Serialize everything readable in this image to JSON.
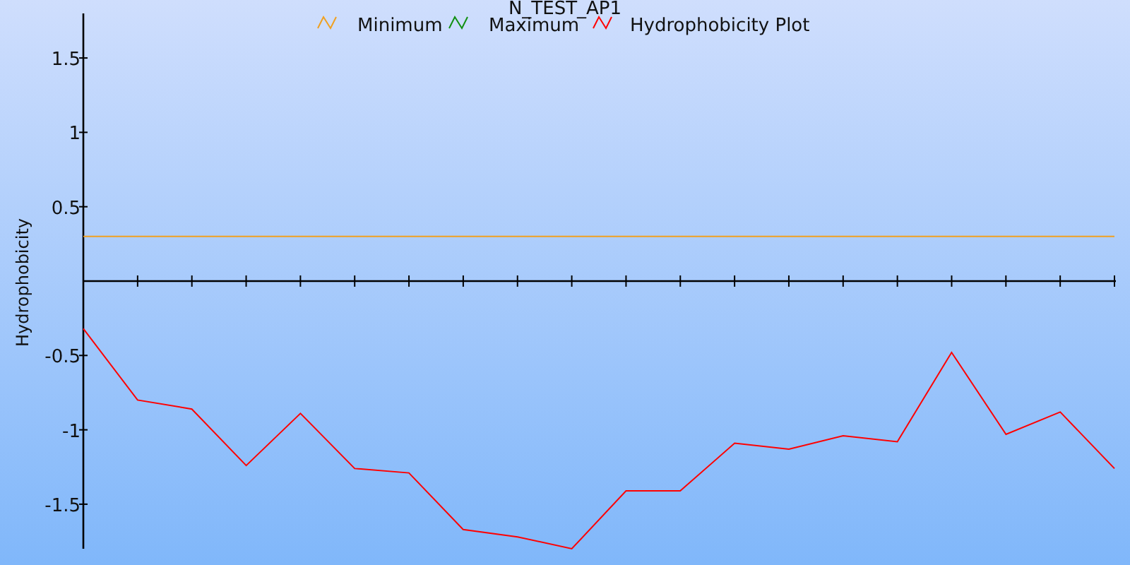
{
  "chart": {
    "chart_data": {
      "type": "line",
      "title": "N_TEST_AP1",
      "ylabel": "Hydrophobicity",
      "legend": true,
      "ylim": [
        -1.8,
        1.8
      ],
      "yticks": [
        -1.5,
        -1,
        -0.5,
        0.5,
        1,
        1.5
      ],
      "series": [
        {
          "name": "Minimum",
          "color": "#f0a020",
          "values": [
            0.3,
            0.3,
            0.3,
            0.3,
            0.3,
            0.3,
            0.3,
            0.3,
            0.3,
            0.3,
            0.3,
            0.3,
            0.3,
            0.3,
            0.3,
            0.3,
            0.3,
            0.3,
            0.3,
            0.3
          ]
        },
        {
          "name": "Maximum",
          "color": "#109010",
          "values": [
            null,
            null,
            null,
            null,
            null,
            null,
            null,
            null,
            null,
            null,
            null,
            null,
            null,
            null,
            null,
            null,
            null,
            null,
            null,
            null
          ]
        },
        {
          "name": "Hydrophobicity Plot",
          "color": "#ff0000",
          "values": [
            -0.32,
            -0.8,
            -0.86,
            -1.24,
            -0.89,
            -1.26,
            -1.29,
            -1.67,
            -1.72,
            -1.8,
            -1.41,
            -1.41,
            -1.09,
            -1.13,
            -1.04,
            -1.08,
            -0.48,
            -1.03,
            -0.88,
            -1.26
          ]
        }
      ]
    }
  }
}
